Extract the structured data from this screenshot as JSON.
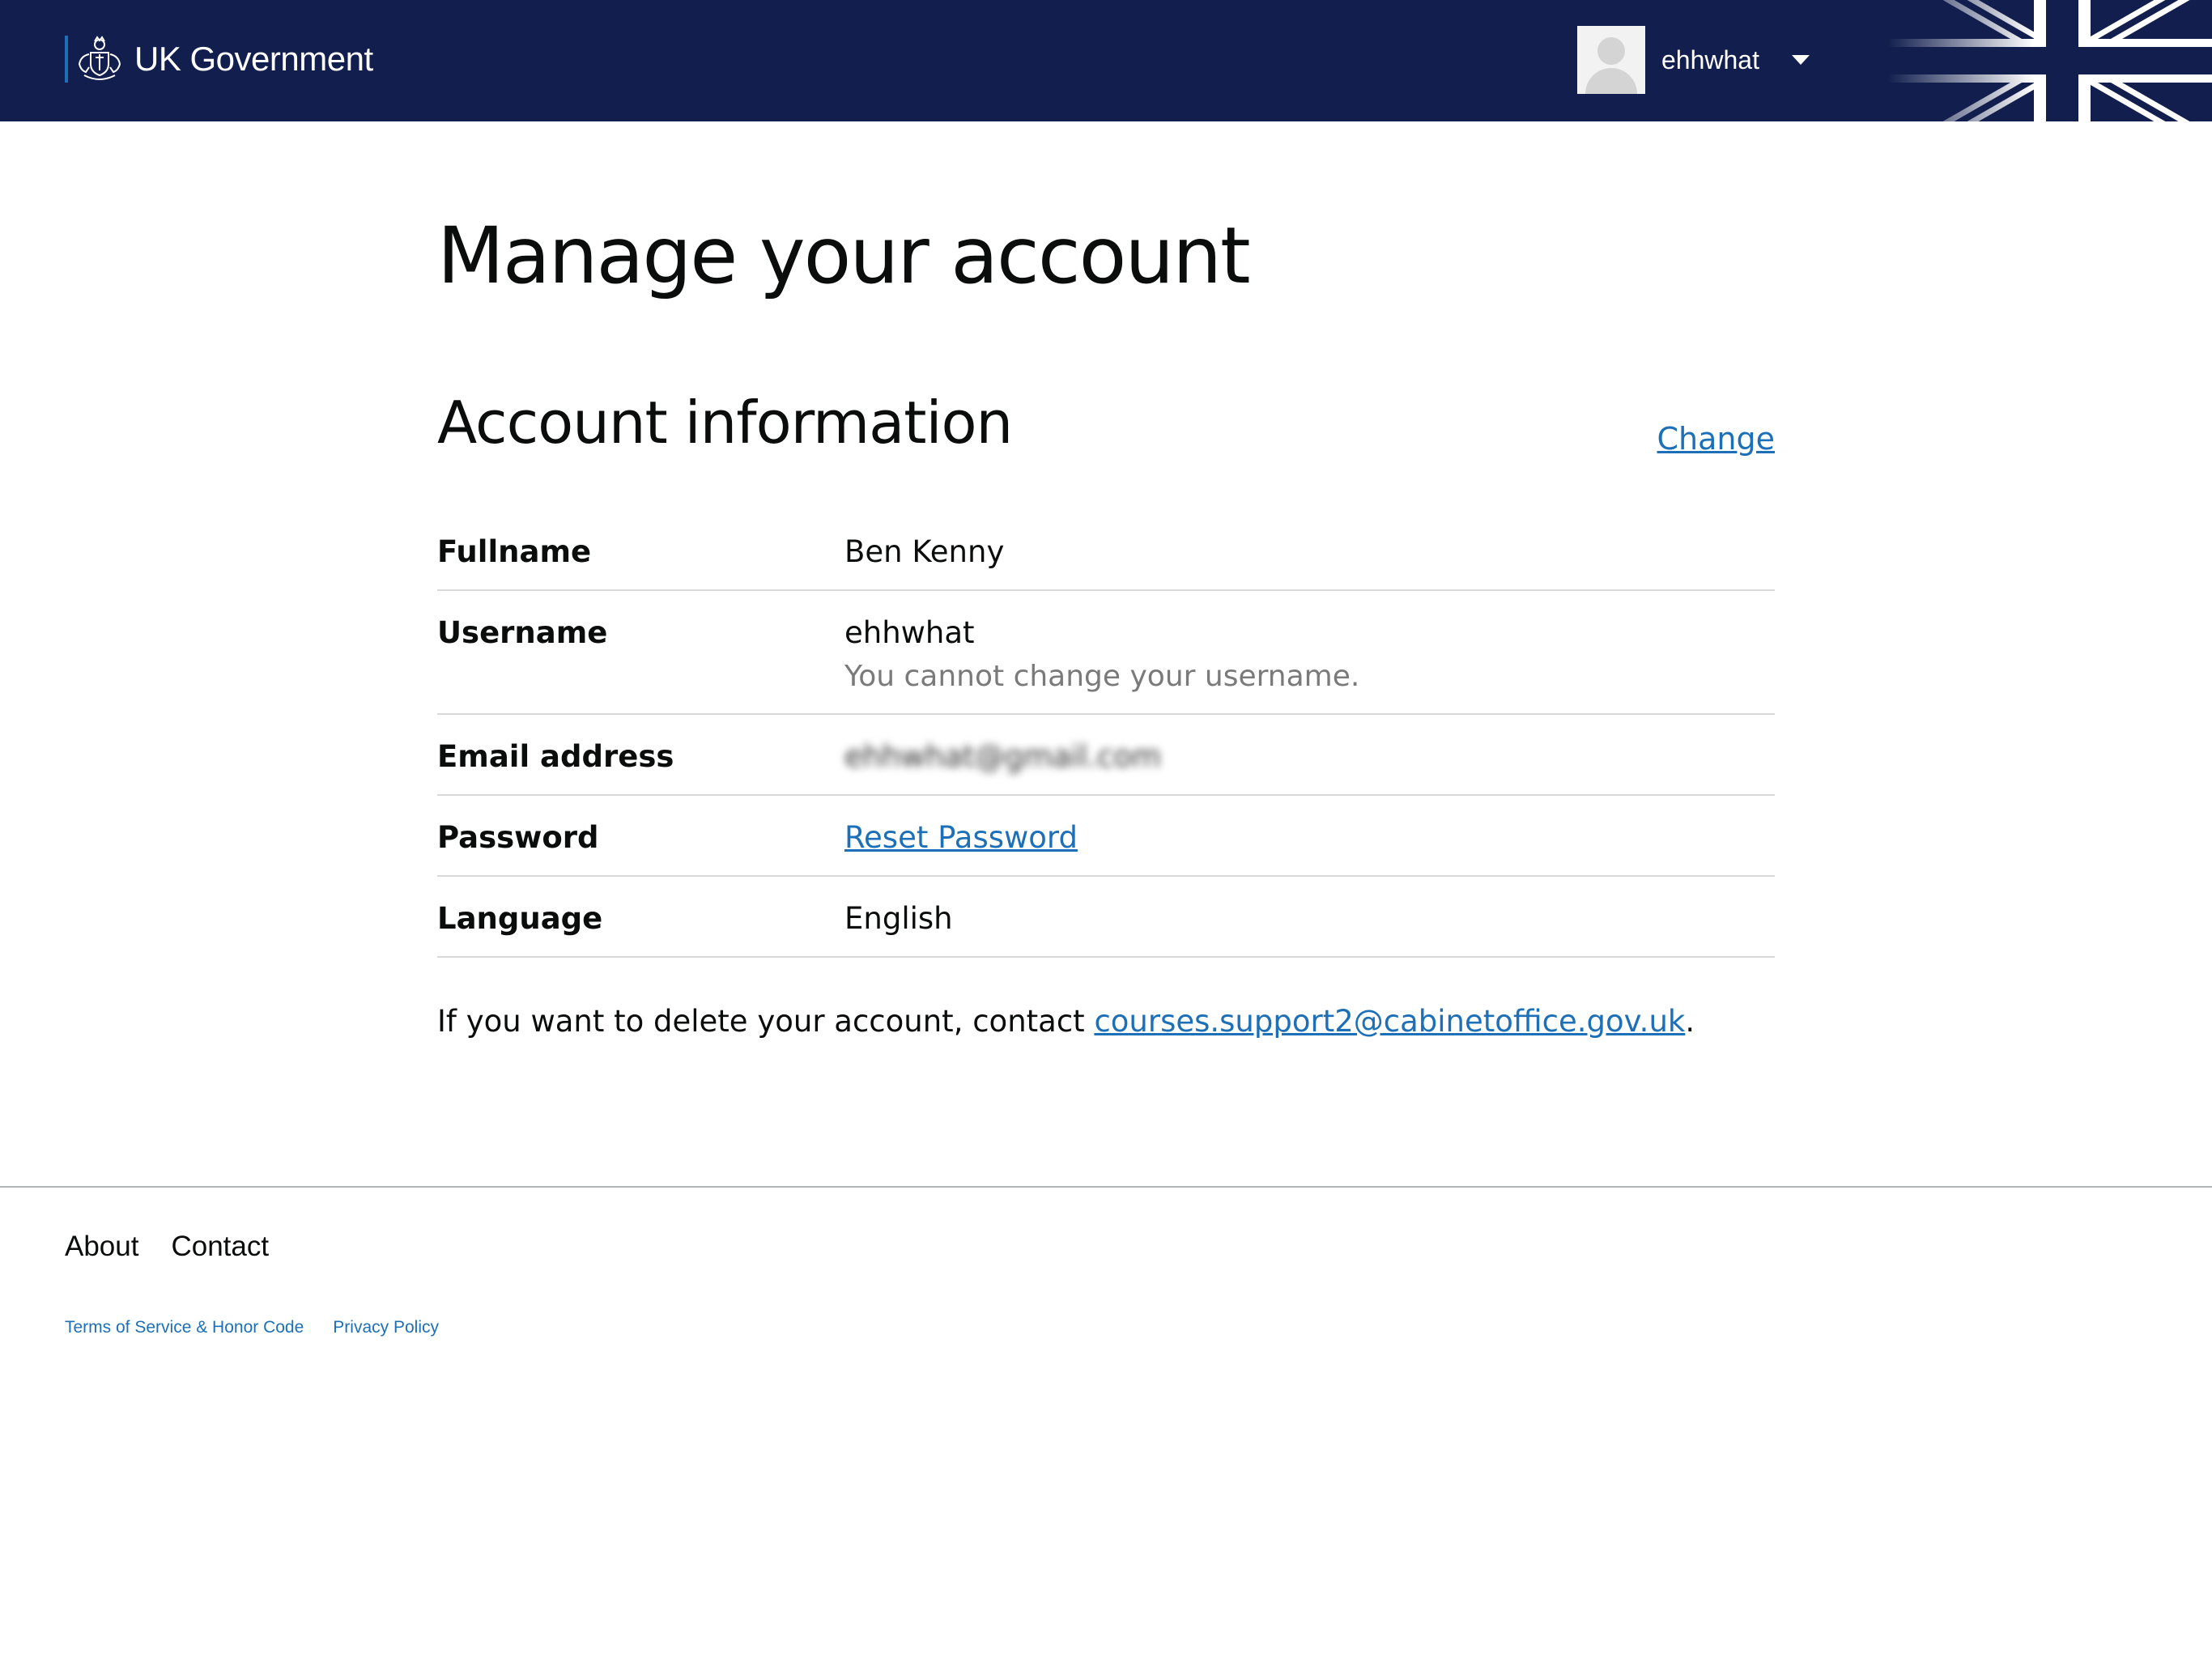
{
  "header": {
    "brand": "UK Government",
    "user": {
      "name": "ehhwhat"
    }
  },
  "main": {
    "page_title": "Manage your account",
    "section_title": "Account information",
    "change_link": "Change",
    "rows": [
      {
        "label": "Fullname",
        "value": "Ben Kenny"
      },
      {
        "label": "Username",
        "value": "ehhwhat",
        "hint": "You cannot change your username."
      },
      {
        "label": "Email address",
        "value": "ehhwhat@gmail.com"
      },
      {
        "label": "Password",
        "link": "Reset Password"
      },
      {
        "label": "Language",
        "value": "English"
      }
    ],
    "delete_note": {
      "prefix": "If you want to delete your account, contact ",
      "email": "courses.support2@cabinetoffice.gov.uk",
      "suffix": "."
    }
  },
  "footer": {
    "nav": [
      "About",
      "Contact"
    ],
    "legal": [
      "Terms of Service & Honor Code",
      "Privacy Policy"
    ]
  },
  "colors": {
    "header_bg": "#121f4e",
    "link": "#1d70b8",
    "divider": "#d9d9d9"
  }
}
